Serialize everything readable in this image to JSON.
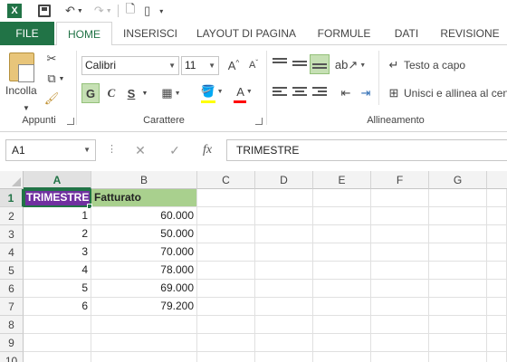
{
  "app": {
    "logo_letter": "X"
  },
  "ribbon": {
    "tabs": [
      {
        "label": "FILE"
      },
      {
        "label": "HOME"
      },
      {
        "label": "INSERISCI"
      },
      {
        "label": "LAYOUT DI PAGINA"
      },
      {
        "label": "FORMULE"
      },
      {
        "label": "DATI"
      },
      {
        "label": "REVISIONE"
      }
    ],
    "clipboard": {
      "paste_label": "Incolla",
      "group_label": "Appunti"
    },
    "font": {
      "name": "Calibri",
      "size": "11",
      "grow": "A",
      "shrink": "A",
      "bold": "G",
      "italic": "C",
      "underline": "S",
      "font_color_letter": "A",
      "group_label": "Carattere",
      "fill_color": "#ffff00",
      "font_color": "#ff0000"
    },
    "alignment": {
      "wrap_text": "Testo a capo",
      "merge_center": "Unisci e allinea al centro",
      "group_label": "Allineamento"
    }
  },
  "formula_bar": {
    "name_box": "A1",
    "fx_label": "fx",
    "content": "TRIMESTRE"
  },
  "sheet": {
    "columns": [
      "A",
      "B",
      "C",
      "D",
      "E",
      "F",
      "G"
    ],
    "rows": [
      "1",
      "2",
      "3",
      "4",
      "5",
      "6",
      "7",
      "8",
      "9",
      "10"
    ],
    "header": {
      "a": "TRIMESTRE",
      "b": "Fatturato"
    },
    "data": [
      {
        "a": "1",
        "b": "60.000"
      },
      {
        "a": "2",
        "b": "50.000"
      },
      {
        "a": "3",
        "b": "70.000"
      },
      {
        "a": "4",
        "b": "78.000"
      },
      {
        "a": "5",
        "b": "69.000"
      },
      {
        "a": "6",
        "b": "79.200"
      }
    ],
    "colors": {
      "header_a": "#7030a0",
      "header_b": "#a9d08e",
      "accent": "#217346"
    }
  }
}
